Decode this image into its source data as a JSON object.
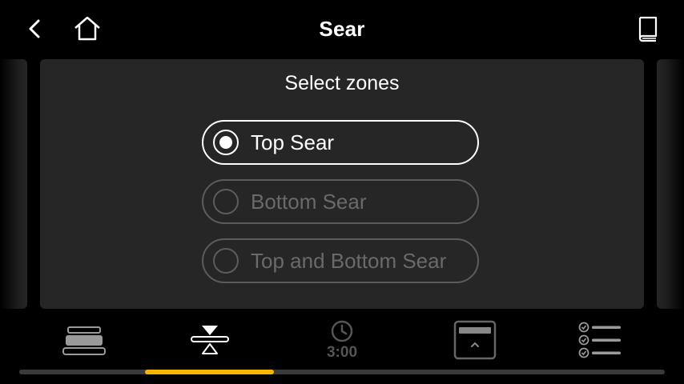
{
  "header": {
    "title": "Sear",
    "back_icon": "chevron-left-icon",
    "home_icon": "home-icon",
    "book_icon": "book-icon"
  },
  "main": {
    "card_title": "Select zones",
    "options": [
      {
        "label": "Top Sear",
        "selected": true
      },
      {
        "label": "Bottom Sear",
        "selected": false
      },
      {
        "label": "Top and Bottom Sear",
        "selected": false
      }
    ]
  },
  "toolbar": {
    "items": [
      {
        "icon": "rack-position-icon"
      },
      {
        "icon": "zone-select-icon",
        "active": true
      },
      {
        "icon": "timer-icon",
        "label": "3:00"
      },
      {
        "icon": "door-icon"
      },
      {
        "icon": "checklist-icon"
      }
    ]
  },
  "colors": {
    "accent": "#f7b500",
    "card_bg": "#262626",
    "disabled_text": "#6a6a6a"
  },
  "pager": {
    "active_index": 1,
    "total": 5
  }
}
